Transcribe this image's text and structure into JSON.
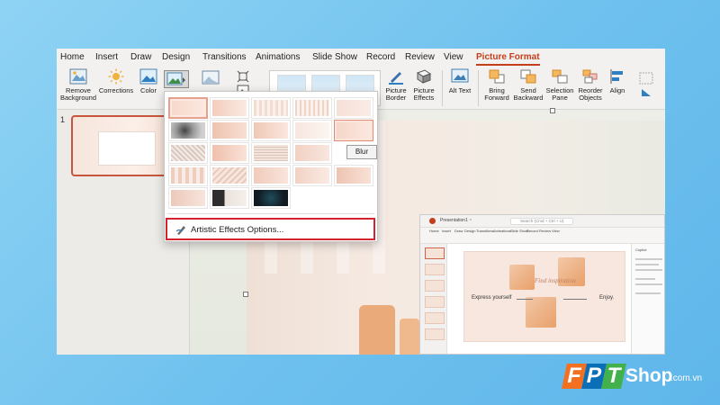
{
  "tabs": [
    "Home",
    "Insert",
    "Draw",
    "Design",
    "Transitions",
    "Animations",
    "Slide Show",
    "Record",
    "Review",
    "View",
    "Picture Format"
  ],
  "ribbon": {
    "remove_background": "Remove Background",
    "corrections": "Corrections",
    "color": "Color",
    "picture_border": "Picture Border",
    "picture_effects": "Picture Effects",
    "alt_text": "Alt Text",
    "bring_forward": "Bring Forward",
    "send_backward": "Send Backward",
    "selection_pane": "Selection Pane",
    "reorder_objects": "Reorder Objects",
    "align": "Align"
  },
  "thumbnail_pane": {
    "slide_number": "1"
  },
  "gallery": {
    "tooltip": "Blur",
    "options_label": "Artistic Effects Options..."
  },
  "embedded_window": {
    "title": "Presentation1 ~",
    "search_placeholder": "Search (Cmd + Ctrl + U)",
    "slide_texts": {
      "express": "Express yourself",
      "find": "Find inspiration",
      "enjoy": "Enjoy."
    },
    "panel_title": "Copilot"
  },
  "watermark": {
    "letters": [
      "F",
      "P",
      "T"
    ],
    "shop": "Shop",
    "domain": ".com.vn"
  },
  "colors": {
    "accent": "#c43e1c",
    "highlight_box": "#d3232e",
    "logo_orange": "#f37021",
    "logo_blue": "#0a6fb7",
    "logo_green": "#43b14b"
  }
}
